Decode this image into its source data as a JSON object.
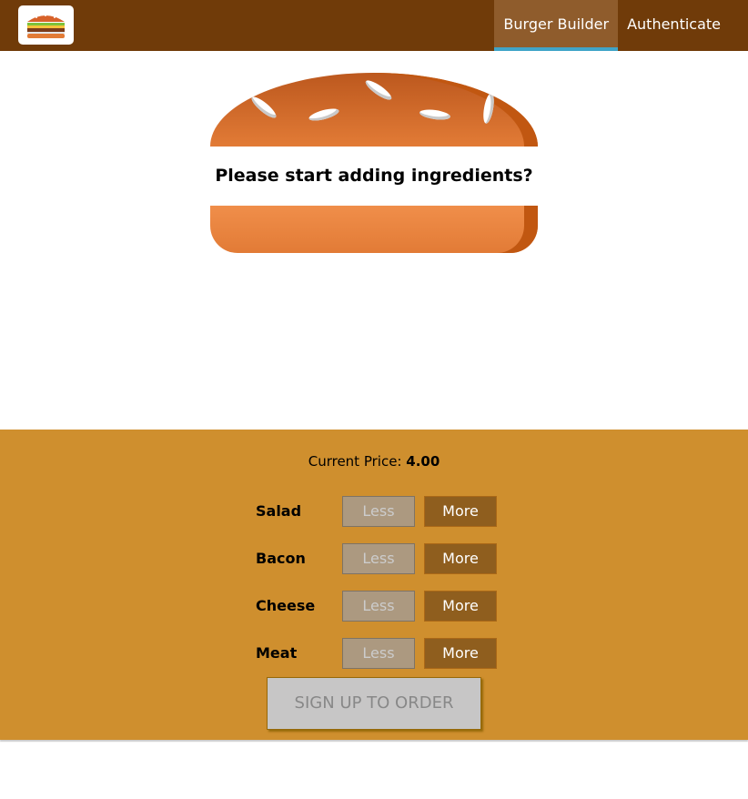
{
  "header": {
    "logo_icon": "burger-logo-icon",
    "nav": [
      {
        "label": "Burger Builder",
        "active": true
      },
      {
        "label": "Authenticate",
        "active": false
      }
    ],
    "colors": {
      "bar": "#703b09",
      "active_bg": "#8f5c2c",
      "active_underline": "#40a4c8"
    }
  },
  "burger": {
    "message": "Please start adding ingredients?"
  },
  "controls": {
    "price_label": "Current Price:",
    "price_value": "4.00",
    "less_label": "Less",
    "more_label": "More",
    "ingredients": [
      {
        "label": "Salad"
      },
      {
        "label": "Bacon"
      },
      {
        "label": "Cheese"
      },
      {
        "label": "Meat"
      }
    ],
    "order_button": "SIGN UP TO ORDER",
    "colors": {
      "panel": "#cf8f2e",
      "more": "#8f5e1e",
      "less": "#ac9980"
    }
  }
}
